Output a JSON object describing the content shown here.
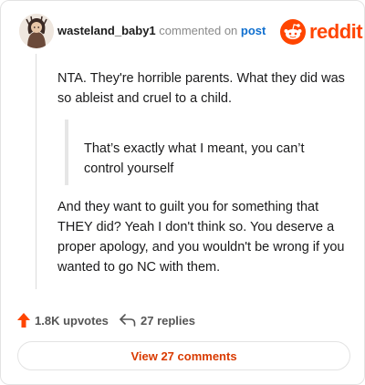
{
  "header": {
    "username": "wasteland_baby1",
    "meta_text": "commented on",
    "post_link": "post",
    "brand": "reddit"
  },
  "comment": {
    "paragraph1": "NTA. They're horrible parents. What they did was so ableist and cruel to a child.",
    "quote": "That’s exactly what I meant, you can’t control yourself",
    "paragraph2": "And they want to guilt you for something that THEY did? Yeah I don't think so. You deserve a proper apology, and you wouldn't be wrong if you wanted to go NC with them."
  },
  "actions": {
    "upvotes": "1.8K upvotes",
    "replies": "27 replies"
  },
  "footer": {
    "view_comments": "View 27 comments"
  },
  "colors": {
    "brand": "#ff4500",
    "link": "#0f6fcf",
    "upvote": "#ff4500",
    "view_comments": "#d93a00"
  },
  "icons": {
    "avatar": "user-avatar",
    "logo": "reddit-logo-icon",
    "upvote": "upvote-arrow-icon",
    "reply": "reply-arrow-icon"
  }
}
